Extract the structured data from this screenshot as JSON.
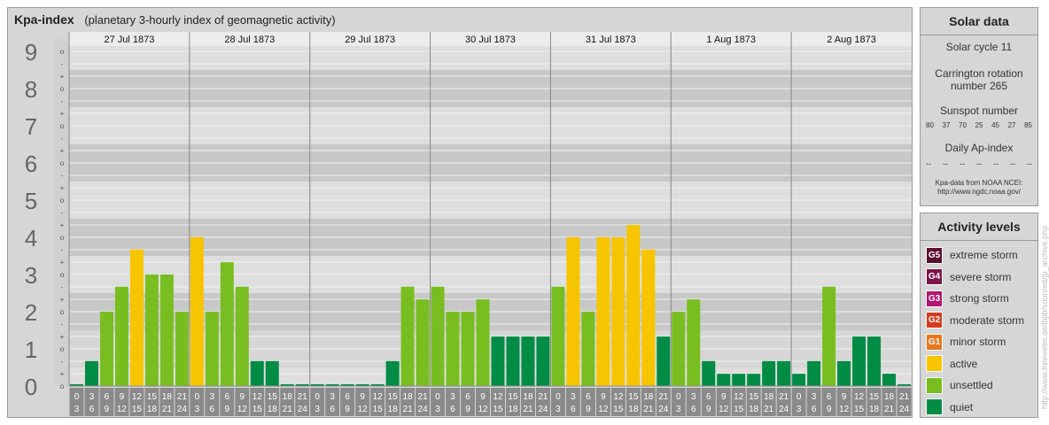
{
  "title": {
    "main": "Kpa-index",
    "subtitle": "(planetary 3-hourly index of geomagnetic activity)"
  },
  "solar": {
    "heading": "Solar data",
    "cycle": "Solar cycle 11",
    "carrington_line1": "Carrington rotation",
    "carrington_line2": "number 265",
    "sunspot_label": "Sunspot number",
    "sunspots": [
      "80",
      "37",
      "70",
      "25",
      "45",
      "27",
      "85"
    ],
    "ap_label": "Daily Ap-index",
    "ap_values": [
      "--",
      "--",
      "--",
      "--",
      "--",
      "--",
      "--"
    ],
    "credit_line1": "Kpa-data from NOAA NCEI:",
    "credit_line2": "http://www.ngdc.noaa.gov/"
  },
  "activity": {
    "heading": "Activity levels",
    "levels": [
      {
        "code": "G5",
        "label": "extreme storm",
        "color": "#5a0f2e"
      },
      {
        "code": "G4",
        "label": "severe storm",
        "color": "#7e1448"
      },
      {
        "code": "G3",
        "label": "strong storm",
        "color": "#b5146f"
      },
      {
        "code": "G2",
        "label": "moderate storm",
        "color": "#d63a1d"
      },
      {
        "code": "G1",
        "label": "minor storm",
        "color": "#e8761a"
      },
      {
        "code": "",
        "label": "active",
        "color": "#f7c400"
      },
      {
        "code": "",
        "label": "unsettled",
        "color": "#78be20"
      },
      {
        "code": "",
        "label": "quiet",
        "color": "#008c45"
      }
    ]
  },
  "watermark": "http://www.freewebs.de/lbjlb/sourced/jp_archive.php",
  "chart_data": {
    "type": "bar",
    "y_ticks": [
      "0",
      "1",
      "2",
      "3",
      "4",
      "5",
      "6",
      "7",
      "8",
      "9"
    ],
    "sub_ticks": [
      "o",
      "+",
      "-"
    ],
    "ylim": [
      0,
      9.33
    ],
    "days": [
      {
        "date": "27 Jul 1873",
        "kp": [
          0.0,
          0.67,
          2.0,
          2.67,
          3.67,
          3.0,
          3.0,
          2.0
        ]
      },
      {
        "date": "28 Jul 1873",
        "kp": [
          4.0,
          2.0,
          3.33,
          2.67,
          0.67,
          0.67,
          0.0,
          0.0
        ]
      },
      {
        "date": "29 Jul 1873",
        "kp": [
          0.0,
          0.0,
          0.0,
          0.0,
          0.0,
          0.67,
          2.67,
          2.33
        ]
      },
      {
        "date": "30 Jul 1873",
        "kp": [
          2.67,
          2.0,
          2.0,
          2.33,
          1.33,
          1.33,
          1.33,
          1.33
        ]
      },
      {
        "date": "31 Jul 1873",
        "kp": [
          2.67,
          4.0,
          2.0,
          4.0,
          4.0,
          4.33,
          3.67,
          1.33
        ]
      },
      {
        "date": "1 Aug 1873",
        "kp": [
          2.0,
          2.33,
          0.67,
          0.33,
          0.33,
          0.33,
          0.67,
          0.67
        ]
      },
      {
        "date": "2 Aug 1873",
        "kp": [
          0.33,
          0.67,
          2.67,
          0.67,
          1.33,
          1.33,
          0.33,
          0.0
        ]
      }
    ],
    "bin_start_labels": [
      "0",
      "3",
      "6",
      "9",
      "12",
      "15",
      "18",
      "21"
    ],
    "bin_end_labels": [
      "3",
      "6",
      "9",
      "12",
      "15",
      "18",
      "21",
      "24"
    ],
    "colors": {
      "quiet": "#008c45",
      "unsettled": "#78be20",
      "active": "#f7c400",
      "minor_storm": "#e8761a"
    },
    "grid": true
  }
}
